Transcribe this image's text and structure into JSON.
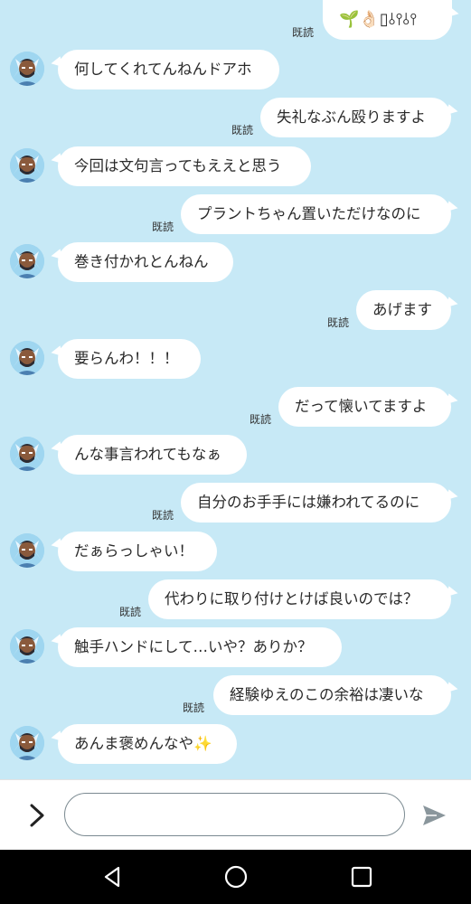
{
  "theme": {
    "background": "#c7e9f6",
    "bubble": "#ffffff",
    "nav": "#000000",
    "send_icon": "#8a969c"
  },
  "chat": {
    "read_label": "既読",
    "messages": [
      {
        "side": "out",
        "text": "🌱👌🏻▯⫰⫯⫰⫯",
        "read": "既読"
      },
      {
        "side": "in",
        "text": "何してくれてんねんドアホ",
        "avatar": "character-avatar-icon"
      },
      {
        "side": "out",
        "text": "失礼なぶん殴りますよ",
        "read": "既読"
      },
      {
        "side": "in",
        "text": "今回は文句言ってもええと思う",
        "avatar": "character-avatar-icon"
      },
      {
        "side": "out",
        "text": "プラントちゃん置いただけなのに",
        "read": "既読"
      },
      {
        "side": "in",
        "text": "巻き付かれとんねん",
        "avatar": "character-avatar-icon"
      },
      {
        "side": "out",
        "text": "あげます",
        "read": "既読"
      },
      {
        "side": "in",
        "text": "要らんわ！！！",
        "avatar": "character-avatar-icon"
      },
      {
        "side": "out",
        "text": "だって懐いてますよ",
        "read": "既読"
      },
      {
        "side": "in",
        "text": "んな事言われてもなぁ",
        "avatar": "character-avatar-icon"
      },
      {
        "side": "out",
        "text": "自分のお手手には嫌われてるのに",
        "read": "既読"
      },
      {
        "side": "in",
        "text": "だぁらっしゃい！",
        "avatar": "character-avatar-icon"
      },
      {
        "side": "out",
        "text": "代わりに取り付けとけば良いのでは？",
        "read": "既読"
      },
      {
        "side": "in",
        "text": "触手ハンドにして…いや？ありか？",
        "avatar": "character-avatar-icon"
      },
      {
        "side": "out",
        "text": "経験ゆえのこの余裕は凄いな",
        "read": "既読"
      },
      {
        "side": "in",
        "text": "あんま褒めんなや✨",
        "avatar": "character-avatar-icon"
      }
    ]
  },
  "input": {
    "value": "",
    "placeholder": ""
  },
  "icons": {
    "expand": "chevron-right-icon",
    "send": "send-icon",
    "back": "back-triangle-icon",
    "home": "home-circle-icon",
    "recents": "recents-square-icon"
  }
}
